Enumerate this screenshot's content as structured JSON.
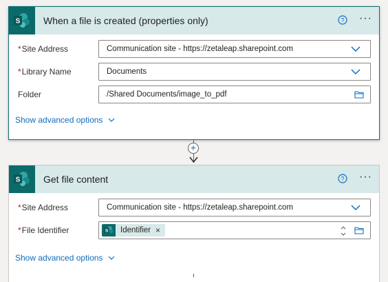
{
  "trigger": {
    "title": "When a file is created (properties only)",
    "fields": {
      "site_address": {
        "label": "Site Address",
        "required": true,
        "value": "Communication site - https://zetaleap.sharepoint.com"
      },
      "library_name": {
        "label": "Library Name",
        "required": true,
        "value": "Documents"
      },
      "folder": {
        "label": "Folder",
        "required": false,
        "value": "/Shared Documents/image_to_pdf"
      }
    },
    "advanced_label": "Show advanced options"
  },
  "action": {
    "title": "Get file content",
    "fields": {
      "site_address": {
        "label": "Site Address",
        "required": true,
        "value": "Communication site - https://zetaleap.sharepoint.com"
      },
      "file_identifier": {
        "label": "File Identifier",
        "required": true,
        "token": "Identifier"
      }
    },
    "advanced_label": "Show advanced options"
  },
  "glyphs": {
    "required": "*",
    "more": "···",
    "plus": "+",
    "remove": "×"
  },
  "colors": {
    "brand": "#0b6a6a",
    "header_bg": "#d7e9e9",
    "link": "#0f6cbd",
    "required": "#a4262c"
  },
  "icons": [
    "sharepoint-logo-icon",
    "help-icon",
    "more-options-icon",
    "chevron-down-icon",
    "folder-icon",
    "add-step-icon",
    "arrow-down-icon",
    "stepper-icon"
  ]
}
